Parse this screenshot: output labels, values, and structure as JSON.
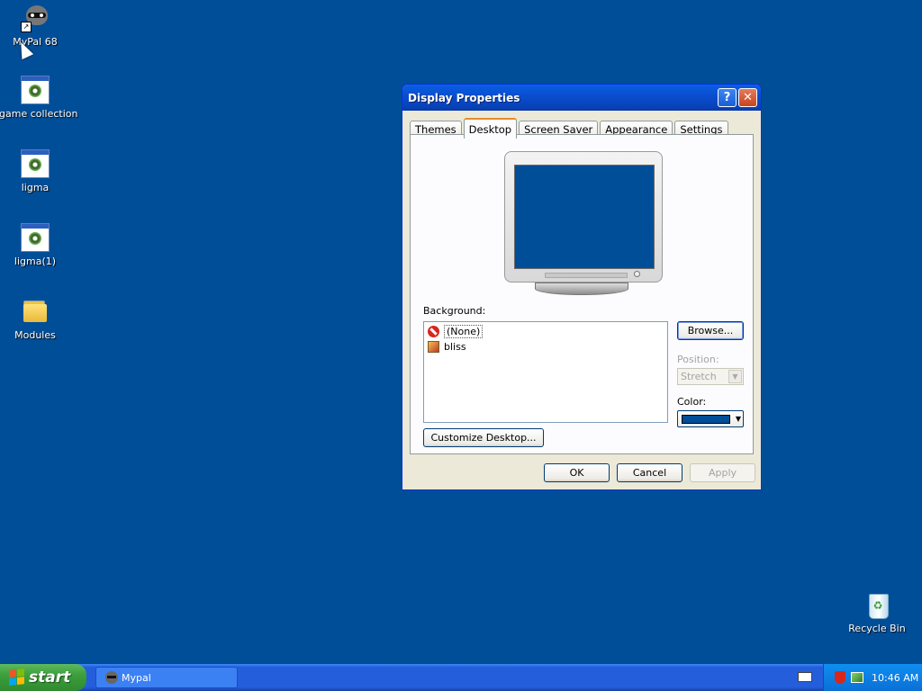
{
  "desktop": {
    "icons": [
      {
        "label": "MyPal 68"
      },
      {
        "label": "game collection"
      },
      {
        "label": "ligma"
      },
      {
        "label": "ligma(1)"
      },
      {
        "label": "Modules"
      },
      {
        "label": "Recycle Bin"
      }
    ],
    "background_color": "#004e98"
  },
  "dialog": {
    "title": "Display Properties",
    "help_glyph": "?",
    "close_glyph": "✕",
    "tabs": [
      "Themes",
      "Desktop",
      "Screen Saver",
      "Appearance",
      "Settings"
    ],
    "active_tab": "Desktop",
    "background_label": "Background:",
    "background_items": [
      "(None)",
      "bliss"
    ],
    "selected_background": "(None)",
    "browse_label": "Browse...",
    "position_label": "Position:",
    "position_value": "Stretch",
    "color_label": "Color:",
    "color_value": "#004e98",
    "customize_label": "Customize Desktop...",
    "ok_label": "OK",
    "cancel_label": "Cancel",
    "apply_label": "Apply"
  },
  "taskbar": {
    "start_label": "start",
    "task_label": "Mypal",
    "clock": "10:46 AM"
  }
}
